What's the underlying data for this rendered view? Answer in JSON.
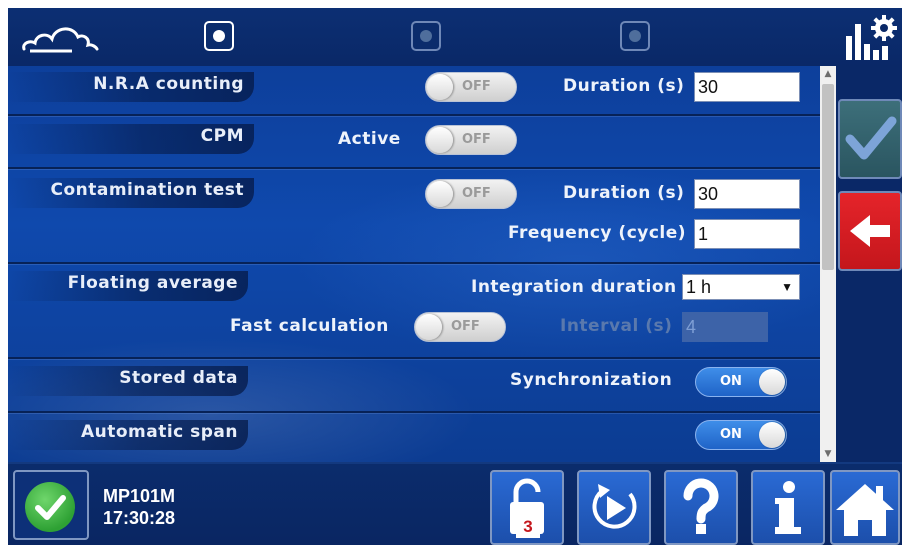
{
  "top_bar": {
    "page_count": 3,
    "active_page": 1
  },
  "rows": {
    "nra": {
      "tag": "N.R.A counting",
      "toggle": "OFF",
      "duration_label": "Duration (s)",
      "duration_value": "30"
    },
    "cpm": {
      "tag": "CPM",
      "active_label": "Active",
      "toggle": "OFF"
    },
    "contamination": {
      "tag": "Contamination test",
      "toggle": "OFF",
      "duration_label": "Duration (s)",
      "duration_value": "30",
      "frequency_label": "Frequency (cycle)",
      "frequency_value": "1"
    },
    "floating": {
      "tag": "Floating average",
      "integration_label": "Integration duration",
      "integration_value": "1 h",
      "fast_label": "Fast calculation",
      "fast_toggle": "OFF",
      "interval_label": "Interval (s)",
      "interval_value": "4"
    },
    "stored": {
      "tag": "Stored data",
      "sync_label": "Synchronization",
      "sync_toggle": "ON"
    },
    "span": {
      "tag": "Automatic span",
      "toggle": "ON"
    }
  },
  "status": {
    "device": "MP101M",
    "time": "17:30:28"
  },
  "bottom_bar": {
    "lock_level": "3"
  },
  "colors": {
    "panel_blue": "#0f49ad",
    "bar_blue": "#0b2c6c",
    "ok_green": "#2ea134",
    "back_red": "#e5242a",
    "confirm_teal": "#3d6f7a"
  },
  "icons": [
    "cloud-logo-icon",
    "chart-gear-icon",
    "check-icon",
    "back-arrow-icon",
    "unlock-icon",
    "play-cycle-icon",
    "help-icon",
    "info-icon",
    "home-icon",
    "status-ok-icon"
  ]
}
